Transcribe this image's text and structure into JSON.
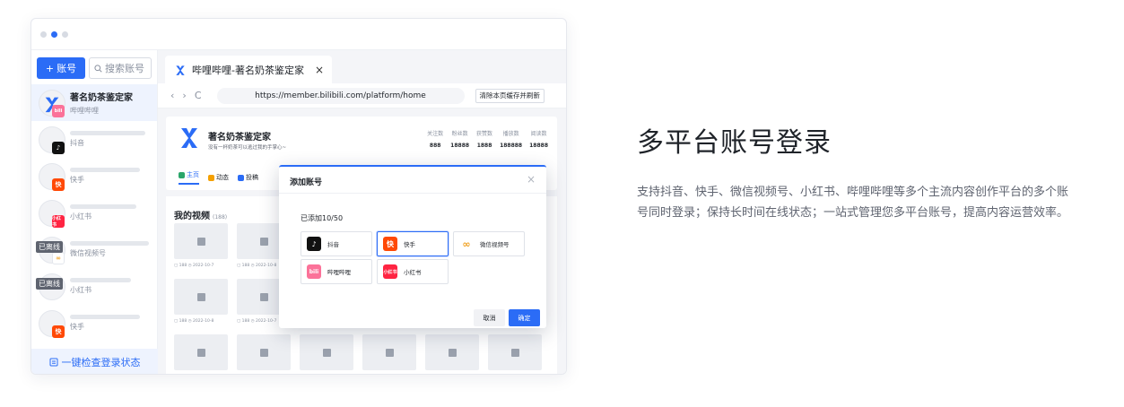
{
  "window": {
    "sidebar": {
      "add_label": "账号",
      "search_placeholder": "搜索账号",
      "accounts": [
        {
          "name": "著名奶茶鉴定家",
          "platform": "哔哩哔哩",
          "badge": "bili"
        },
        {
          "name": "",
          "platform": "抖音",
          "badge": "douyin"
        },
        {
          "name": "",
          "platform": "快手",
          "badge": "kuaishou"
        },
        {
          "name": "",
          "platform": "小红书",
          "badge": "xiaohongshu"
        },
        {
          "name": "",
          "platform": "微信视频号",
          "badge": "wechat",
          "status": "已离线"
        },
        {
          "name": "",
          "platform": "小红书",
          "badge": "none",
          "status": "已离线"
        },
        {
          "name": "",
          "platform": "快手",
          "badge": "kuaishou"
        }
      ],
      "footer_label": "一键检查登录状态"
    },
    "tab": {
      "title": "哔哩哔哩-著名奶茶鉴定家",
      "close": "×"
    },
    "address": {
      "back": "‹",
      "forward": "›",
      "reload": "C",
      "url": "https://member.bilibili.com/platform/home",
      "refresh_button": "清除本页缓存并刷新"
    },
    "profile": {
      "name": "著名奶茶鉴定家",
      "desc": "没有一杯奶茶可以逃过我的手掌心~",
      "stats": [
        {
          "label": "关注数",
          "value": "888"
        },
        {
          "label": "粉丝数",
          "value": "18888"
        },
        {
          "label": "获赞数",
          "value": "1888"
        },
        {
          "label": "播放数",
          "value": "188888"
        },
        {
          "label": "阅读数",
          "value": "18888"
        }
      ],
      "tabs": [
        "主页",
        "动态",
        "投稿"
      ]
    },
    "videos": {
      "title": "我的视频",
      "count": "(188)",
      "meta_views": "188",
      "meta_dates": [
        "2022-10-7",
        "2022-10-8",
        "2022-10-7",
        "2022-10-8",
        "2022-10-7",
        "2022-10-8",
        "2022-10-7"
      ]
    },
    "modal": {
      "title": "添加账号",
      "close": "×",
      "count": "已添加10/50",
      "platforms": [
        {
          "name": "抖音",
          "selected": false
        },
        {
          "name": "快手",
          "selected": true
        },
        {
          "name": "微信视频号",
          "selected": false
        },
        {
          "name": "哔哩哔哩",
          "selected": false
        },
        {
          "name": "小红书",
          "selected": false
        }
      ],
      "cancel": "取消",
      "ok": "确定"
    }
  },
  "feature": {
    "headline": "多平台账号登录",
    "description": "支持抖音、快手、微信视频号、小红书、哔哩哔哩等多个主流内容创作平台的多个账号同时登录；保持长时间在线状态；一站式管理您多平台账号，提高内容运营效率。"
  },
  "colors": {
    "accent": "#2b6cf6",
    "douyin": "#111111",
    "kuaishou": "#ff4906",
    "xiaohongshu": "#ff2442",
    "bilibili": "#fb7299"
  },
  "badge_texts": {
    "douyin": "♪",
    "kuaishou": "快",
    "xiaohongshu": "小红书",
    "bili": "bili",
    "wechat": "∞"
  }
}
